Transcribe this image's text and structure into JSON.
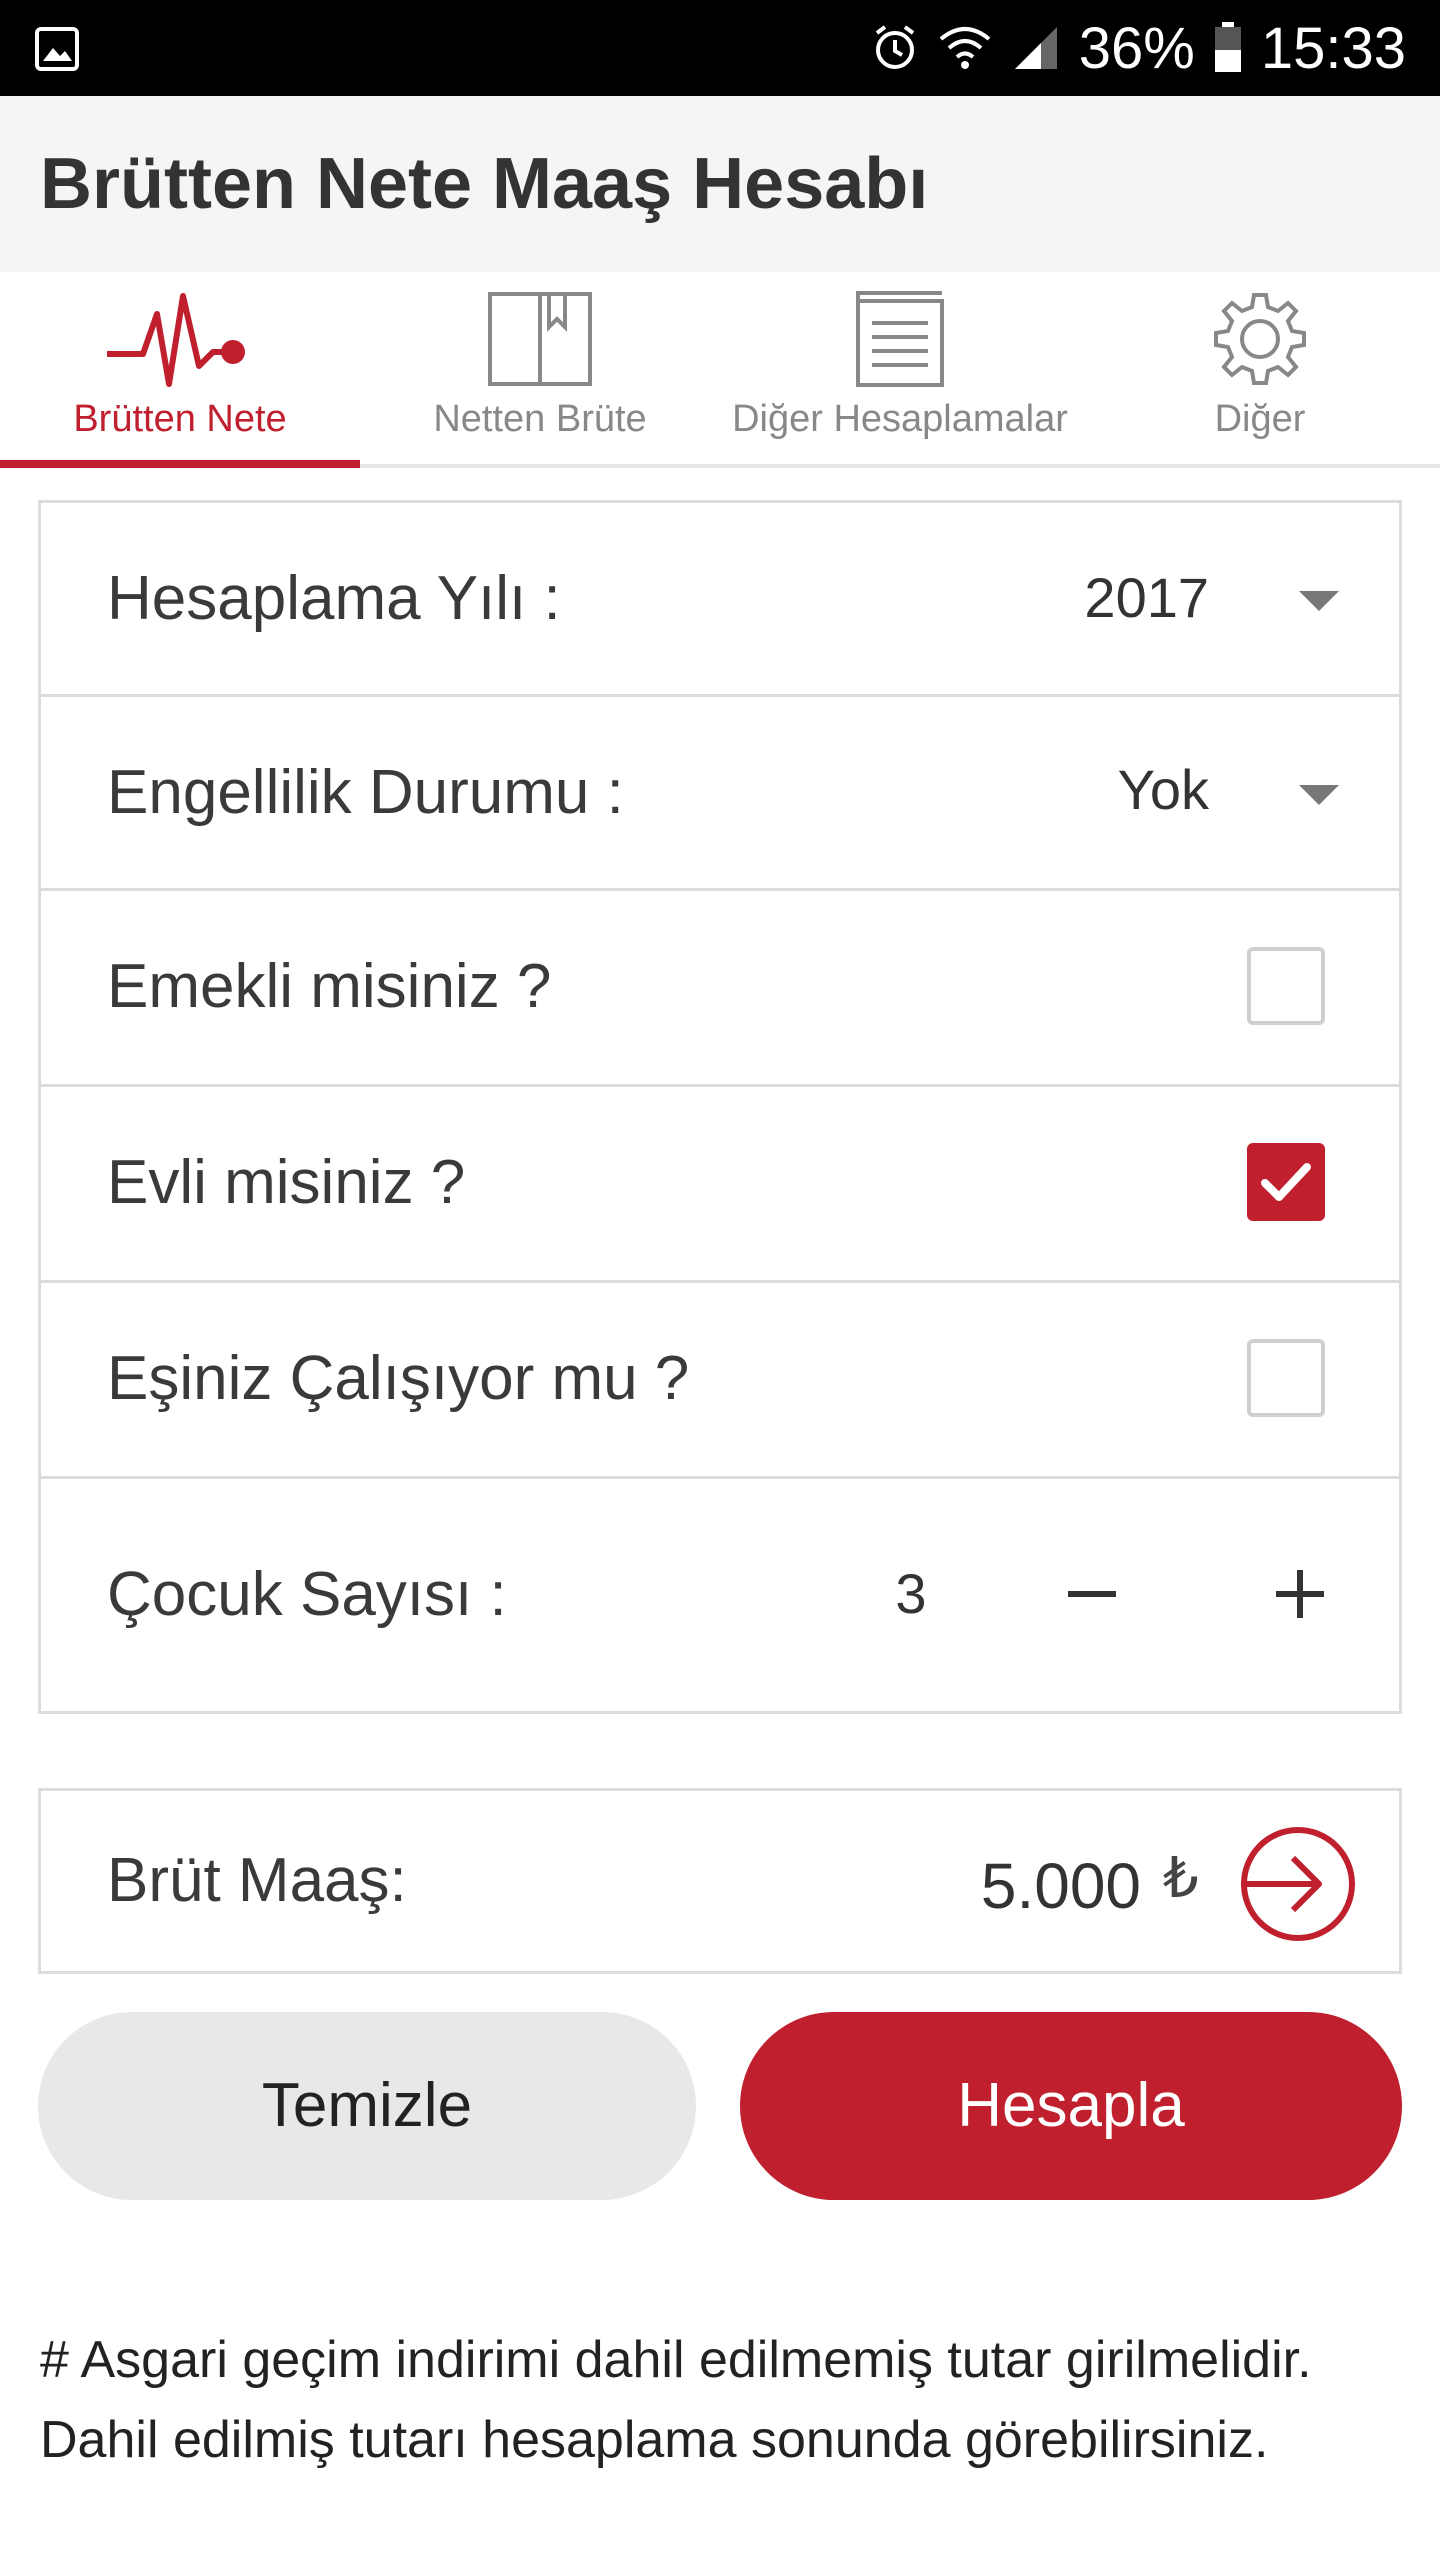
{
  "status_bar": {
    "battery": "36%",
    "time": "15:33",
    "icons": [
      "gallery-icon",
      "alarm-icon",
      "wifi-icon",
      "signal-icon",
      "battery-icon"
    ]
  },
  "app_bar": {
    "title": "Brütten Nete Maaş Hesabı"
  },
  "tabs": [
    {
      "label": "Brütten Nete",
      "icon": "heartbeat-icon",
      "active": true
    },
    {
      "label": "Netten Brüte",
      "icon": "book-icon",
      "active": false
    },
    {
      "label": "Diğer Hesaplamalar",
      "icon": "document-icon",
      "active": false
    },
    {
      "label": "Diğer",
      "icon": "gear-icon",
      "active": false
    }
  ],
  "form": {
    "year": {
      "label": "Hesaplama Yılı :",
      "value": "2017"
    },
    "disability": {
      "label": "Engellilik Durumu :",
      "value": "Yok"
    },
    "retired": {
      "label": "Emekli misiniz ?",
      "checked": false
    },
    "married": {
      "label": "Evli misiniz ?",
      "checked": true
    },
    "spouse_working": {
      "label": "Eşiniz Çalışıyor mu ?",
      "checked": false
    },
    "children": {
      "label": "Çocuk Sayısı :",
      "value": "3"
    }
  },
  "salary": {
    "label": "Brüt Maaş:",
    "value": "5.000",
    "currency": "₺"
  },
  "buttons": {
    "clear": "Temizle",
    "calculate": "Hesapla"
  },
  "note": "# Asgari geçim indirimi dahil edilmemiş tutar girilmelidir. Dahil edilmiş tutarı hesaplama sonunda görebilirsiniz.",
  "colors": {
    "accent": "#c0202e",
    "border": "#dcdcdc",
    "appbar": "#f5f5f5",
    "button_secondary": "#e8e8e8"
  }
}
